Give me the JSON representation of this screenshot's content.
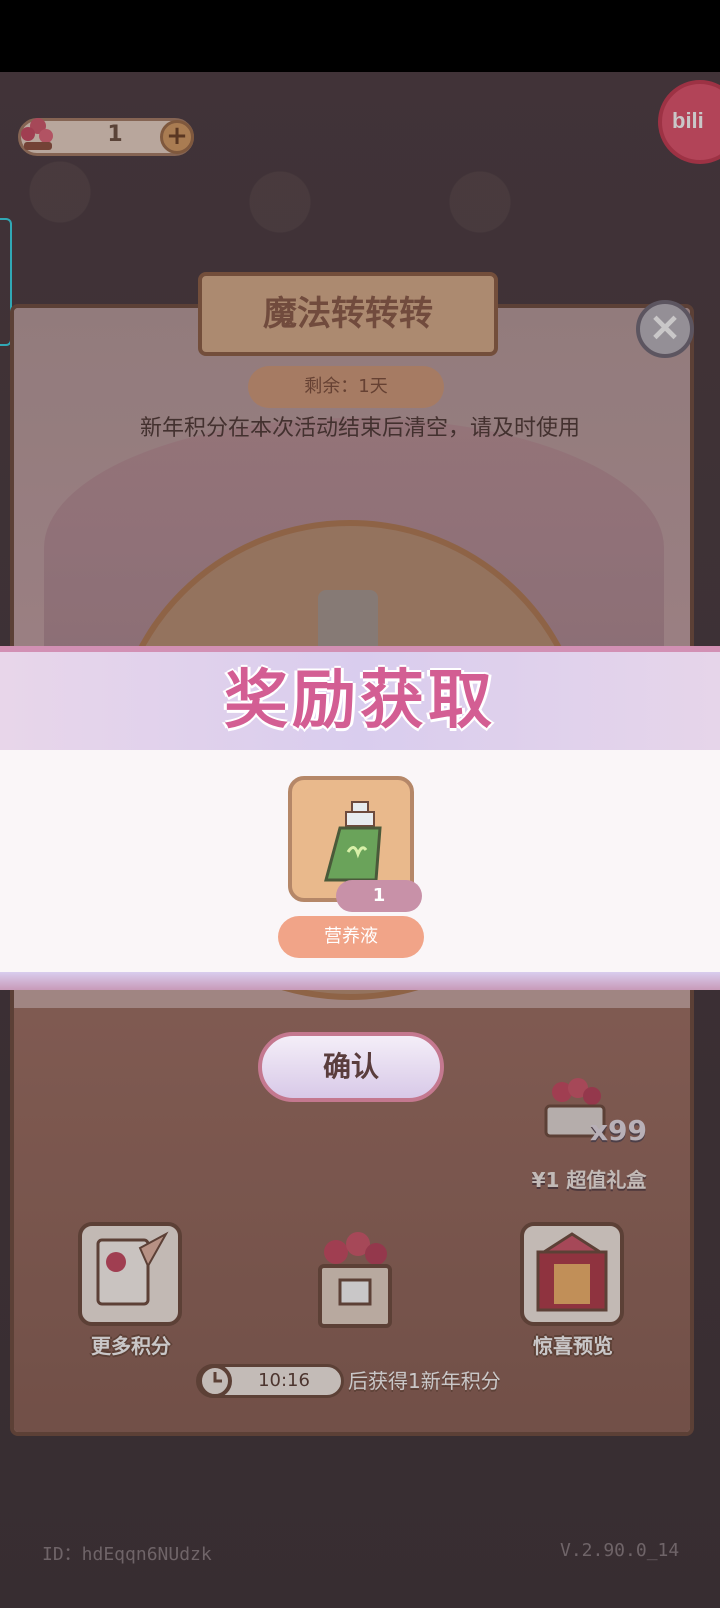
{
  "top_bar": {
    "resource_count": "1",
    "plus_label": "+"
  },
  "corner_badge": {
    "label": "bili"
  },
  "panel": {
    "title": "魔法转转转",
    "close_label": "×",
    "remaining": "剩余：1天",
    "notice": "新年积分在本次活动结束后清空，请及时使用"
  },
  "reward_dialog": {
    "title": "奖励获取",
    "item": {
      "icon": "nutrient-bottle-icon",
      "quantity": "1",
      "name": "营养液"
    },
    "confirm_label": "确认"
  },
  "gift_box": {
    "count": "x99",
    "label": "¥1 超值礼盒"
  },
  "actions": {
    "more_points": "更多积分",
    "preview": "惊喜预览"
  },
  "timer": {
    "time": "10:16",
    "suffix": "后获得1新年积分"
  },
  "footer": {
    "id": "ID：hdEqqn6NUdzk",
    "version": "V.2.90.0_14"
  },
  "colors": {
    "reward_title": "#d35e93",
    "name_pill": "#f1a488",
    "qty_pill": "#c891a8"
  }
}
